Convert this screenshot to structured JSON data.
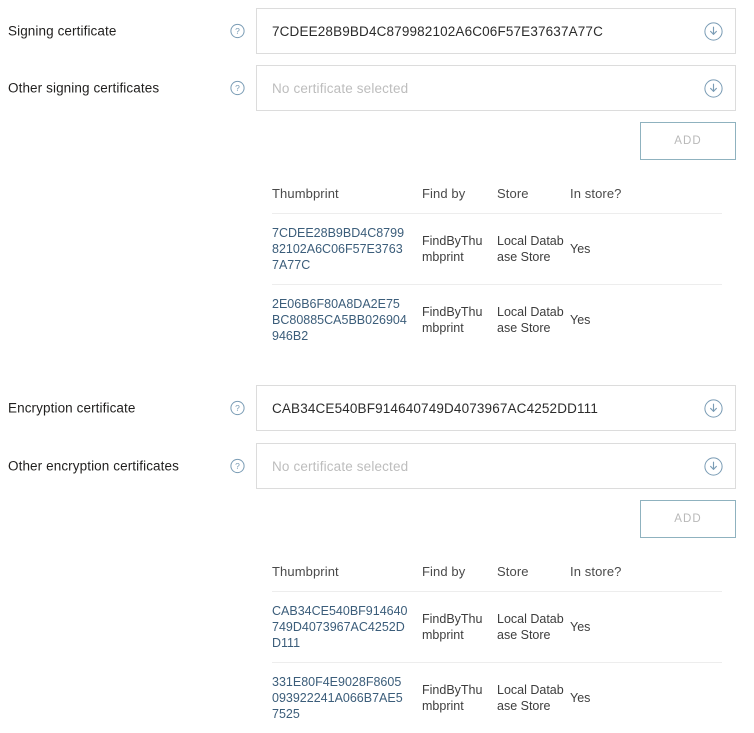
{
  "sections": [
    {
      "id": "signing",
      "primary_field": {
        "label": "Signing certificate",
        "value": "7CDEE28B9BD4C879982102A6C06F57E37637A77C",
        "help_icon": "help-circle-icon",
        "download_icon": "download-circle-icon"
      },
      "other_field": {
        "label": "Other signing certificates",
        "value": "",
        "placeholder": "No certificate selected",
        "help_icon": "help-circle-icon",
        "download_icon": "download-circle-icon"
      },
      "add_label": "ADD",
      "table": {
        "headers": [
          "Thumbprint",
          "Find by",
          "Store",
          "In store?"
        ],
        "rows": [
          {
            "thumbprint": "7CDEE28B9BD4C879982102A6C06F57E37637A77C",
            "find_by": "FindByThumbprint",
            "store": "Local Database Store",
            "in_store": "Yes"
          },
          {
            "thumbprint": "2E06B6F80A8DA2E75BC80885CA5BB026904946B2",
            "find_by": "FindByThumbprint",
            "store": "Local Database Store",
            "in_store": "Yes"
          }
        ]
      }
    },
    {
      "id": "encryption",
      "primary_field": {
        "label": "Encryption certificate",
        "value": "CAB34CE540BF914640749D4073967AC4252DD111",
        "help_icon": "help-circle-icon",
        "download_icon": "download-circle-icon"
      },
      "other_field": {
        "label": "Other encryption certificates",
        "value": "",
        "placeholder": "No certificate selected",
        "help_icon": "help-circle-icon",
        "download_icon": "download-circle-icon"
      },
      "add_label": "ADD",
      "table": {
        "headers": [
          "Thumbprint",
          "Find by",
          "Store",
          "In store?"
        ],
        "rows": [
          {
            "thumbprint": "CAB34CE540BF914640749D4073967AC4252DD111",
            "find_by": "FindByThumbprint",
            "store": "Local Database Store",
            "in_store": "Yes"
          },
          {
            "thumbprint": "331E80F4E9028F8605093922241A066B7AE57525",
            "find_by": "FindByThumbprint",
            "store": "Local Database Store",
            "in_store": "Yes"
          }
        ]
      }
    }
  ],
  "colors": {
    "label_text": "#201f1e",
    "input_border": "#dcdcdc",
    "placeholder": "#bdbdbd",
    "add_border": "#8fb2bf",
    "add_text": "#b9b9b9",
    "link": "#3b5d7a",
    "icon": "#7a9cb5",
    "row_divider": "#ededed"
  }
}
